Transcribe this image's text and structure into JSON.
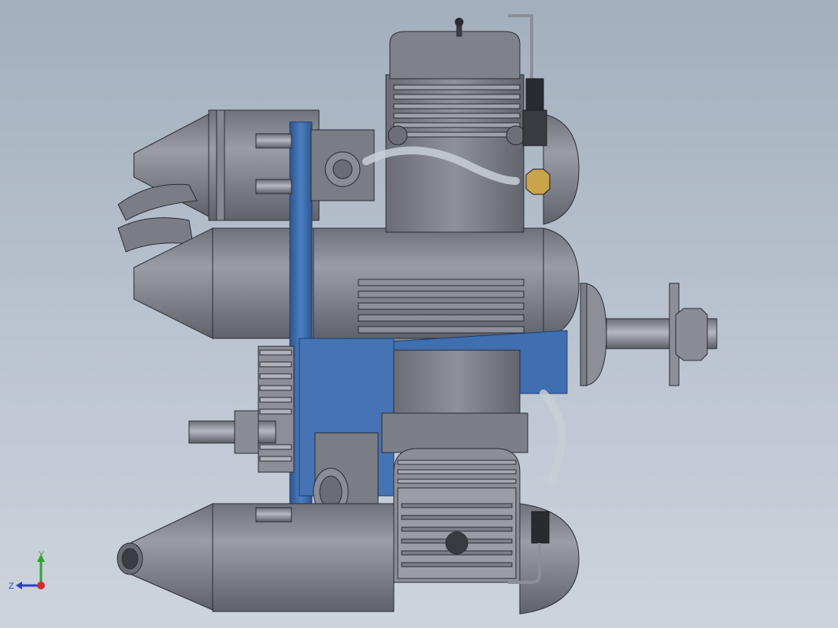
{
  "viewport": {
    "background_top": "#a3afbd",
    "background_bottom": "#cdd4dd"
  },
  "model": {
    "part_color": "#7b7e87",
    "part_dark": "#5a5d66",
    "part_light": "#9a9da6",
    "mount_color": "#3f6fb0",
    "mount_dark": "#2e568f",
    "tube_color": "#c9cfd6",
    "brass_color": "#c9a44a"
  },
  "triad": {
    "y_label": "Y",
    "z_label": "Z",
    "y_color": "#2fa52f",
    "x_color": "#d62a2a",
    "z_color": "#2a3fd6"
  }
}
